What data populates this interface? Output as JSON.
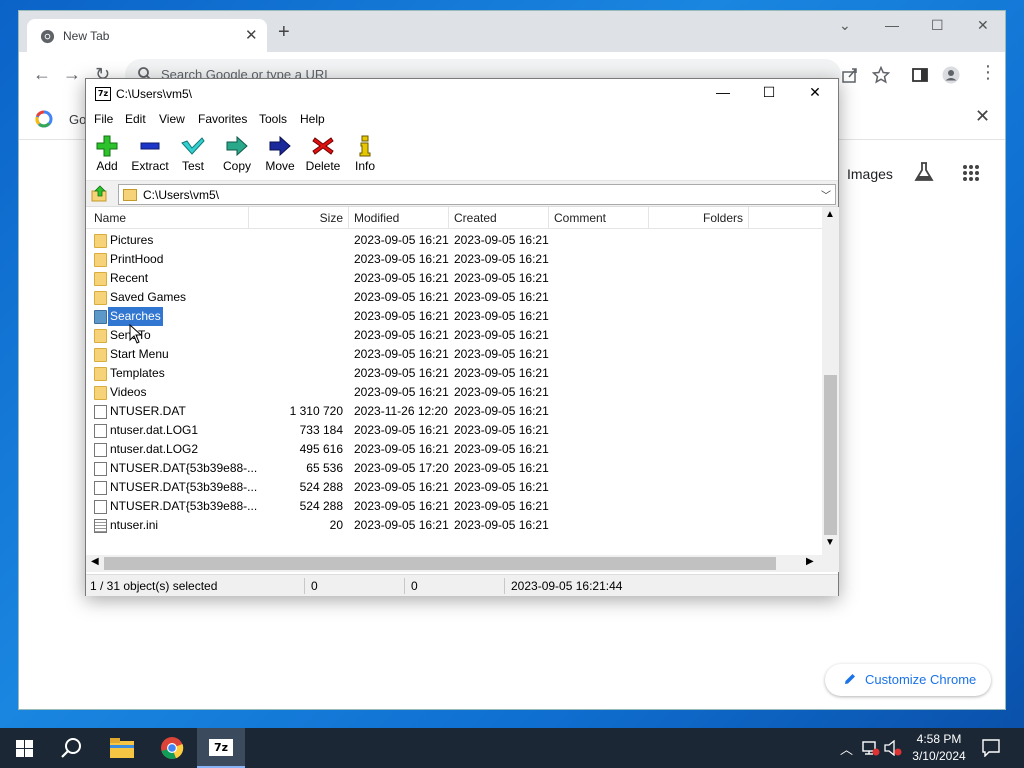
{
  "chrome": {
    "tab_title": "New Tab",
    "omnibox_placeholder": "Search Google or type a URL",
    "bookmark_text": "Go",
    "ntp_images": "Images",
    "customize_label": "Customize Chrome",
    "colors": {
      "tabstrip": "#dee1e6",
      "accent": "#1a73e8"
    }
  },
  "zip": {
    "title": "C:\\Users\\vm5\\",
    "logo_text": "7z",
    "menu": [
      "File",
      "Edit",
      "View",
      "Favorites",
      "Tools",
      "Help"
    ],
    "toolbar": [
      {
        "label": "Add",
        "icon": "plus-icon"
      },
      {
        "label": "Extract",
        "icon": "minus-icon"
      },
      {
        "label": "Test",
        "icon": "check-icon"
      },
      {
        "label": "Copy",
        "icon": "copy-arrow-icon"
      },
      {
        "label": "Move",
        "icon": "move-arrow-icon"
      },
      {
        "label": "Delete",
        "icon": "delete-x-icon"
      },
      {
        "label": "Info",
        "icon": "info-icon"
      }
    ],
    "address": "C:\\Users\\vm5\\",
    "columns": [
      "Name",
      "Size",
      "Modified",
      "Created",
      "Comment",
      "Folders"
    ],
    "rows": [
      {
        "name": "Pictures",
        "size": "",
        "modified": "2023-09-05 16:21",
        "created": "2023-09-05 16:21",
        "type": "folder"
      },
      {
        "name": "PrintHood",
        "size": "",
        "modified": "2023-09-05 16:21",
        "created": "2023-09-05 16:21",
        "type": "folder"
      },
      {
        "name": "Recent",
        "size": "",
        "modified": "2023-09-05 16:21",
        "created": "2023-09-05 16:21",
        "type": "folder"
      },
      {
        "name": "Saved Games",
        "size": "",
        "modified": "2023-09-05 16:21",
        "created": "2023-09-05 16:21",
        "type": "folder"
      },
      {
        "name": "Searches",
        "size": "",
        "modified": "2023-09-05 16:21",
        "created": "2023-09-05 16:21",
        "type": "folder",
        "selected": true
      },
      {
        "name": "SendTo",
        "size": "",
        "modified": "2023-09-05 16:21",
        "created": "2023-09-05 16:21",
        "type": "folder"
      },
      {
        "name": "Start Menu",
        "size": "",
        "modified": "2023-09-05 16:21",
        "created": "2023-09-05 16:21",
        "type": "folder"
      },
      {
        "name": "Templates",
        "size": "",
        "modified": "2023-09-05 16:21",
        "created": "2023-09-05 16:21",
        "type": "folder"
      },
      {
        "name": "Videos",
        "size": "",
        "modified": "2023-09-05 16:21",
        "created": "2023-09-05 16:21",
        "type": "folder"
      },
      {
        "name": "NTUSER.DAT",
        "size": "1 310 720",
        "modified": "2023-11-26 12:20",
        "created": "2023-09-05 16:21",
        "type": "file"
      },
      {
        "name": "ntuser.dat.LOG1",
        "size": "733 184",
        "modified": "2023-09-05 16:21",
        "created": "2023-09-05 16:21",
        "type": "file"
      },
      {
        "name": "ntuser.dat.LOG2",
        "size": "495 616",
        "modified": "2023-09-05 16:21",
        "created": "2023-09-05 16:21",
        "type": "file"
      },
      {
        "name": "NTUSER.DAT{53b39e88-...",
        "size": "65 536",
        "modified": "2023-09-05 17:20",
        "created": "2023-09-05 16:21",
        "type": "file"
      },
      {
        "name": "NTUSER.DAT{53b39e88-...",
        "size": "524 288",
        "modified": "2023-09-05 16:21",
        "created": "2023-09-05 16:21",
        "type": "file"
      },
      {
        "name": "NTUSER.DAT{53b39e88-...",
        "size": "524 288",
        "modified": "2023-09-05 16:21",
        "created": "2023-09-05 16:21",
        "type": "file"
      },
      {
        "name": "ntuser.ini",
        "size": "20",
        "modified": "2023-09-05 16:21",
        "created": "2023-09-05 16:21",
        "type": "ini"
      }
    ],
    "status": {
      "selected": "1 / 31 object(s) selected",
      "size": "0",
      "packed": "0",
      "modified": "2023-09-05 16:21:44"
    },
    "colors": {
      "selection": "#3176d1",
      "folder": "#f6d378"
    }
  },
  "taskbar": {
    "time": "4:58 PM",
    "date": "3/10/2024"
  }
}
